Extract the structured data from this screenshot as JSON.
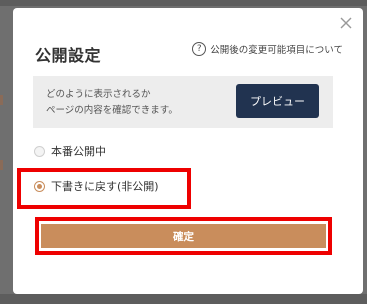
{
  "dialog": {
    "title": "公開設定",
    "help_text": "公開後の変更可能項目について",
    "help_icon": "question-circle-icon",
    "close_icon": "close-icon"
  },
  "preview": {
    "text_line1": "どのように表示されるか",
    "text_line2": "ページの内容を確認できます。",
    "button_label": "プレビュー"
  },
  "options": {
    "publish_label": "本番公開中",
    "draft_label": "下書きに戻す(非公開)",
    "selected": "draft"
  },
  "confirm": {
    "label": "確定"
  },
  "colors": {
    "accent": "#c98d5c",
    "preview_button": "#213350",
    "highlight": "#ee0000",
    "overlay": "#6f6f6f"
  }
}
